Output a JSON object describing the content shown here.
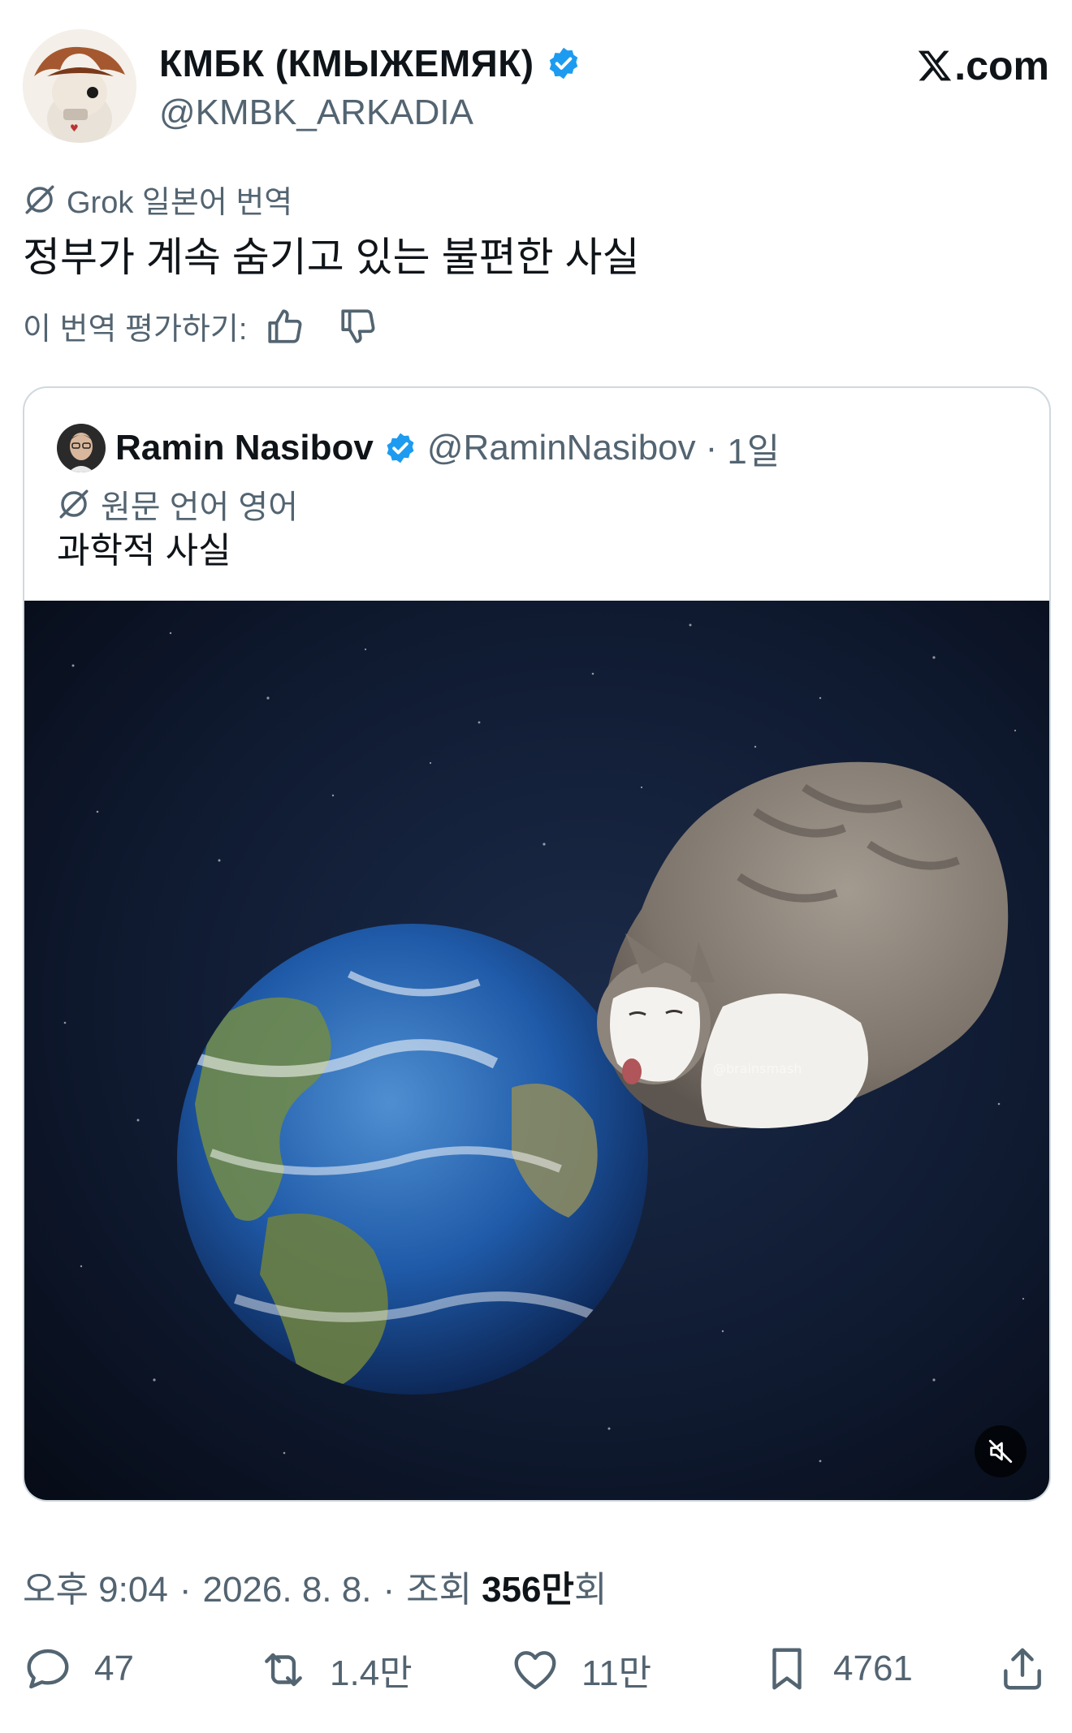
{
  "author": {
    "name": "КМБК (КМЫЖЕМЯК)",
    "handle": "@KMBK_ARKADIA",
    "verified": true
  },
  "brand": {
    "label": ".com",
    "logo_icon": "x-logo-icon"
  },
  "translation": {
    "source_label": "Grok 일본어 번역",
    "text": "정부가 계속 숨기고 있는 불편한 사실",
    "rate_label": "이 번역 평가하기:"
  },
  "quoted_post": {
    "author_name": "Ramin Nasibov",
    "handle": "@RaminNasibov",
    "separator": "·",
    "time": "1일",
    "language_label": "원문 언어 영어",
    "text": "과학적 사실",
    "media_watermark": "@brainsmash"
  },
  "meta": {
    "time": "오후 9:04",
    "sep1": "·",
    "date": "2026. 8. 8.",
    "sep2": "·",
    "views_label": "조회",
    "views_count": "356만",
    "views_suffix": "회"
  },
  "actions": {
    "replies": "47",
    "reposts": "1.4만",
    "likes": "11만",
    "bookmarks": "4761"
  },
  "colors": {
    "text": "#0f1419",
    "secondary": "#536471",
    "verified": "#1d9bf0",
    "border": "#cfd9de"
  }
}
